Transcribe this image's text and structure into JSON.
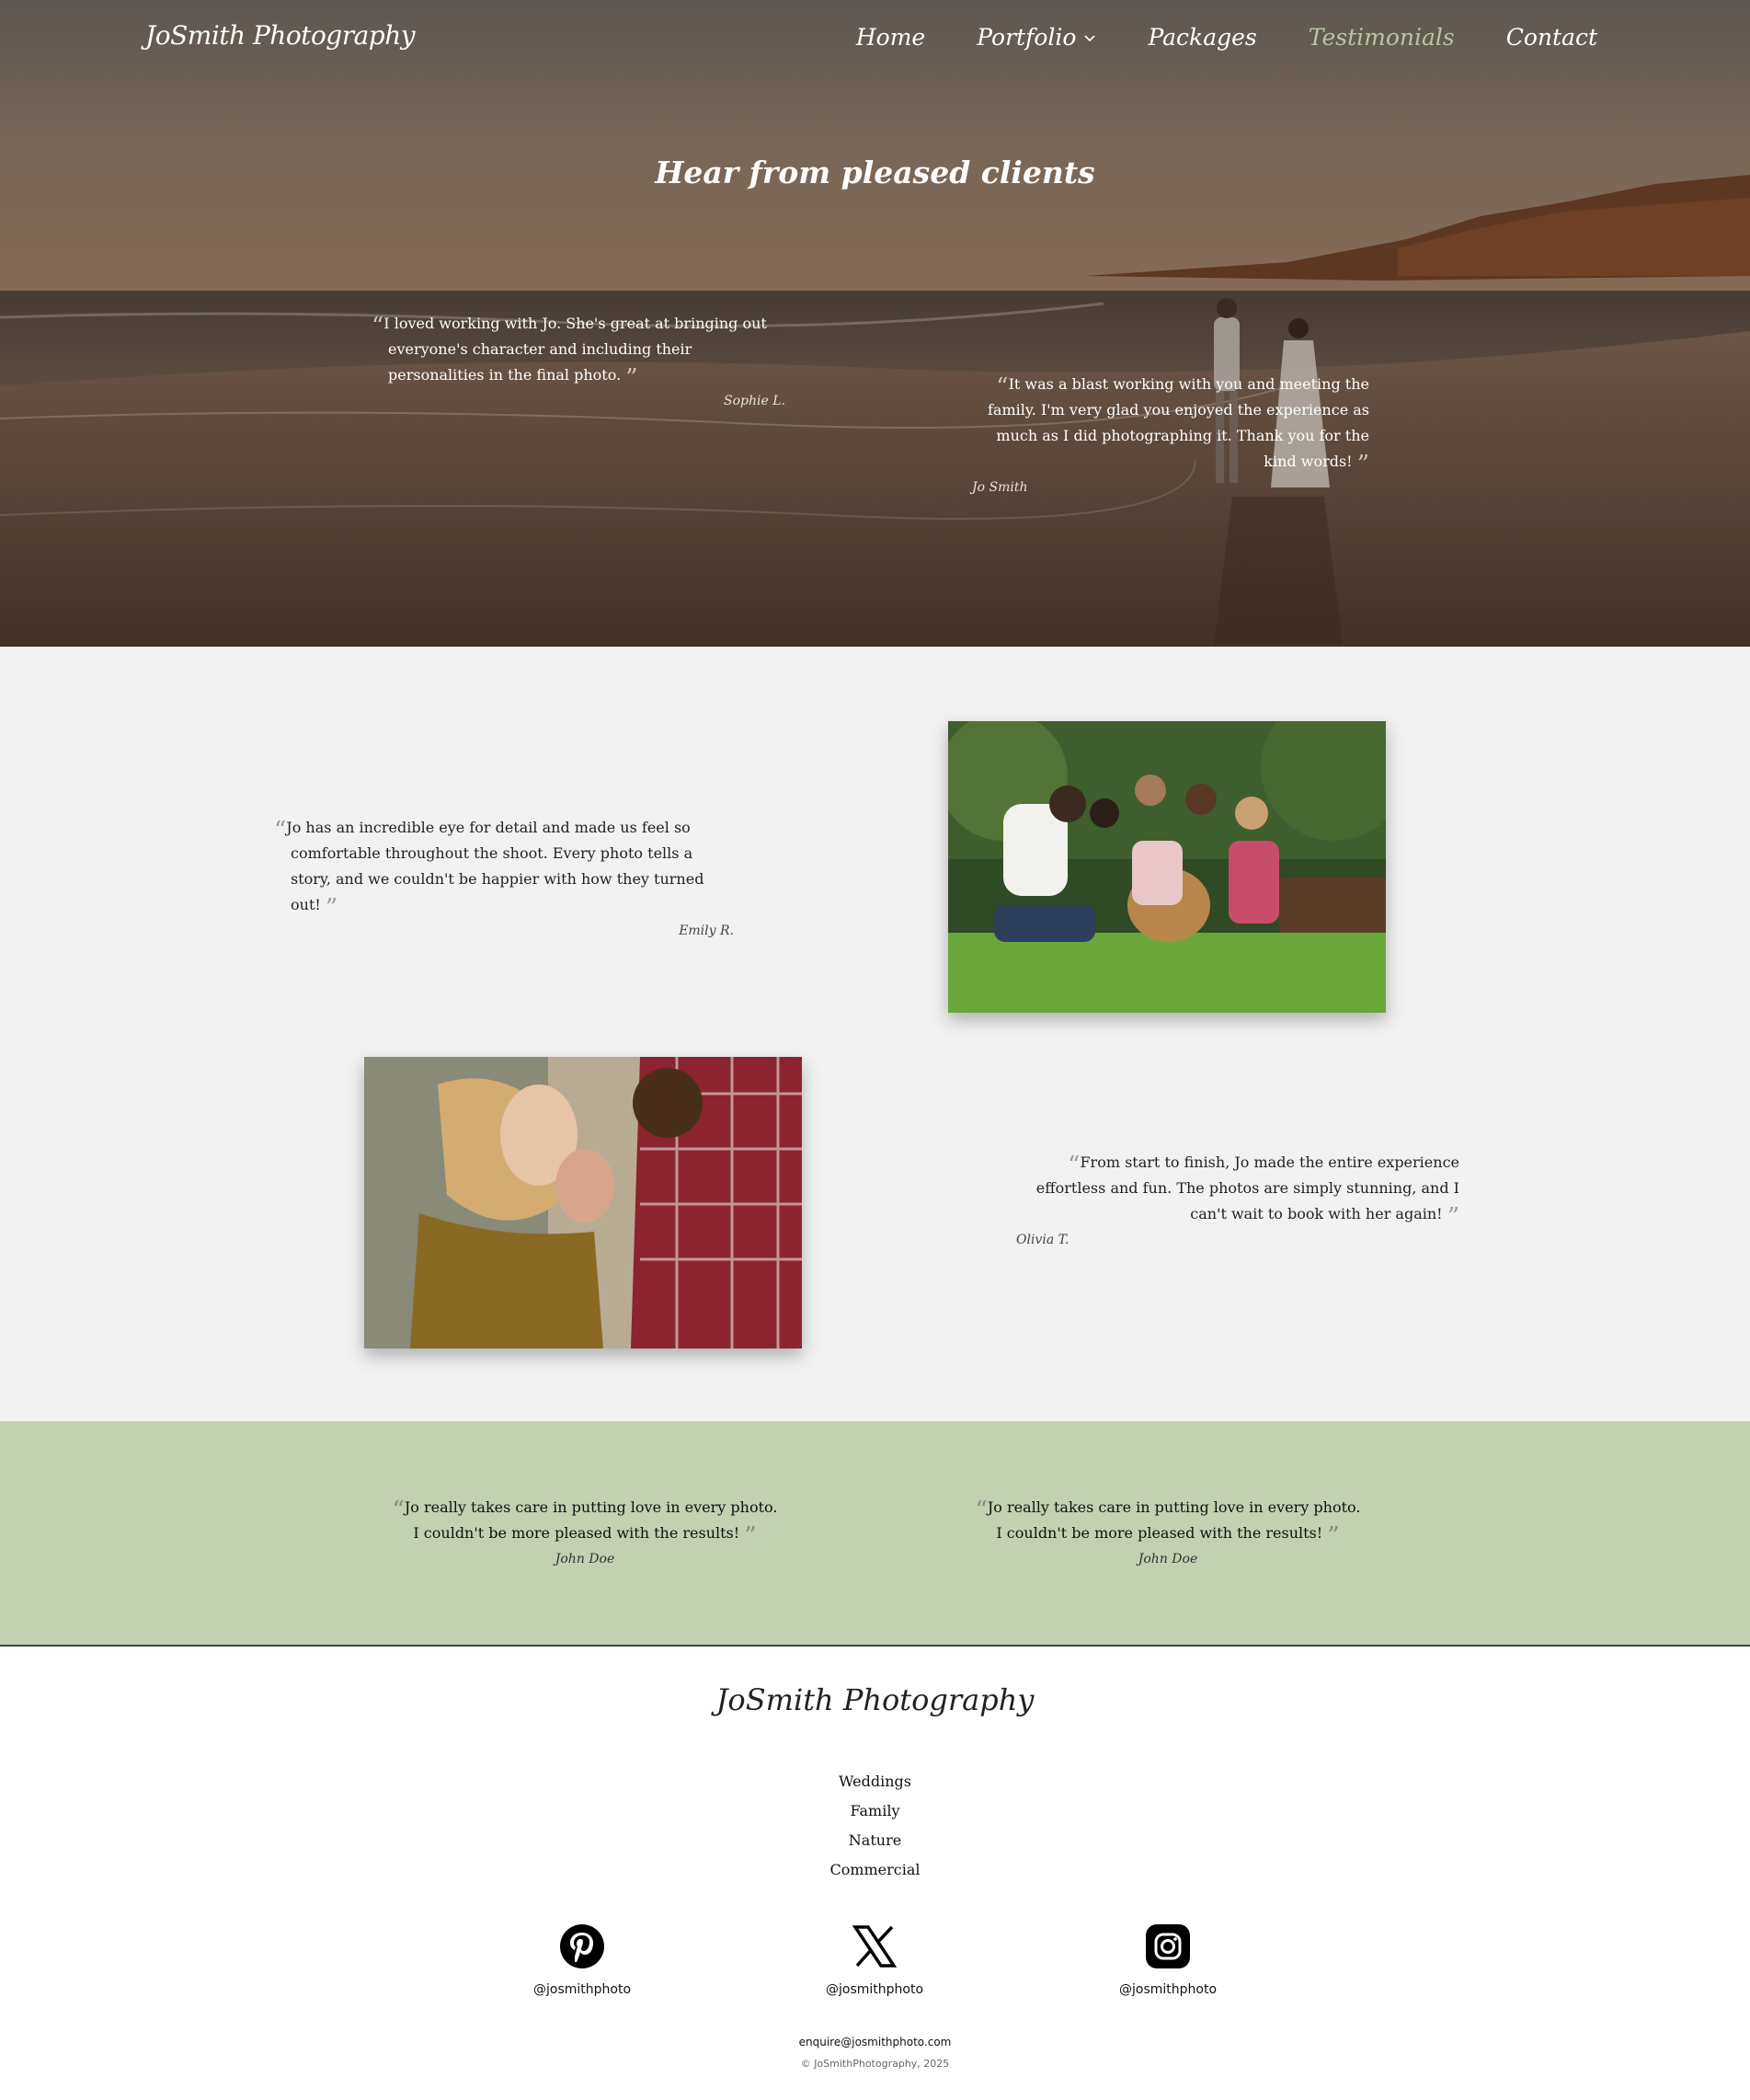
{
  "header": {
    "brand": "JoSmith Photography",
    "nav": [
      {
        "label": "Home"
      },
      {
        "label": "Portfolio"
      },
      {
        "label": "Packages"
      },
      {
        "label": "Testimonials"
      },
      {
        "label": "Contact"
      }
    ],
    "active_nav": "Testimonials"
  },
  "hero": {
    "title": "Hear from pleased clients",
    "quotes": [
      {
        "text": "I loved working with Jo. She's great at bringing out everyone's character and including their personalities in the final photo.",
        "author": "Sophie L."
      },
      {
        "text": "It was a blast working with you and meeting the family. I'm very glad you enjoyed the experience as much as I did photographing it. Thank you for the kind words!",
        "author": "Jo Smith"
      }
    ]
  },
  "gallery": {
    "quotes": [
      {
        "text": "Jo has an incredible eye for detail and made us feel so comfortable throughout the shoot. Every photo tells a story, and we couldn't be happier with how they turned out!",
        "author": "Emily R."
      },
      {
        "text": "From start to finish, Jo made the entire experience effortless and fun. The photos are simply stunning, and I can't wait to book with her again!",
        "author": "Olivia T."
      }
    ]
  },
  "band": {
    "quotes": [
      {
        "text": "Jo really takes care in putting love in every photo. I couldn't be more pleased with the results!",
        "author": "John Doe"
      },
      {
        "text": "Jo really takes care in putting love in every photo. I couldn't be more pleased with the results!",
        "author": "John Doe"
      }
    ]
  },
  "footer": {
    "brand": "JoSmith Photography",
    "links": [
      "Weddings",
      "Family",
      "Nature",
      "Commercial"
    ],
    "socials": [
      {
        "icon": "pinterest-icon",
        "handle": "@josmithphoto"
      },
      {
        "icon": "x-icon",
        "handle": "@josmithphoto"
      },
      {
        "icon": "instagram-icon",
        "handle": "@josmithphoto"
      }
    ],
    "email": "enquire@josmithphoto.com",
    "copyright": "© JoSmithPhotography, 2025"
  },
  "colors": {
    "accent_green": "#c1d1b2",
    "active_nav": "#b4c8a0"
  }
}
